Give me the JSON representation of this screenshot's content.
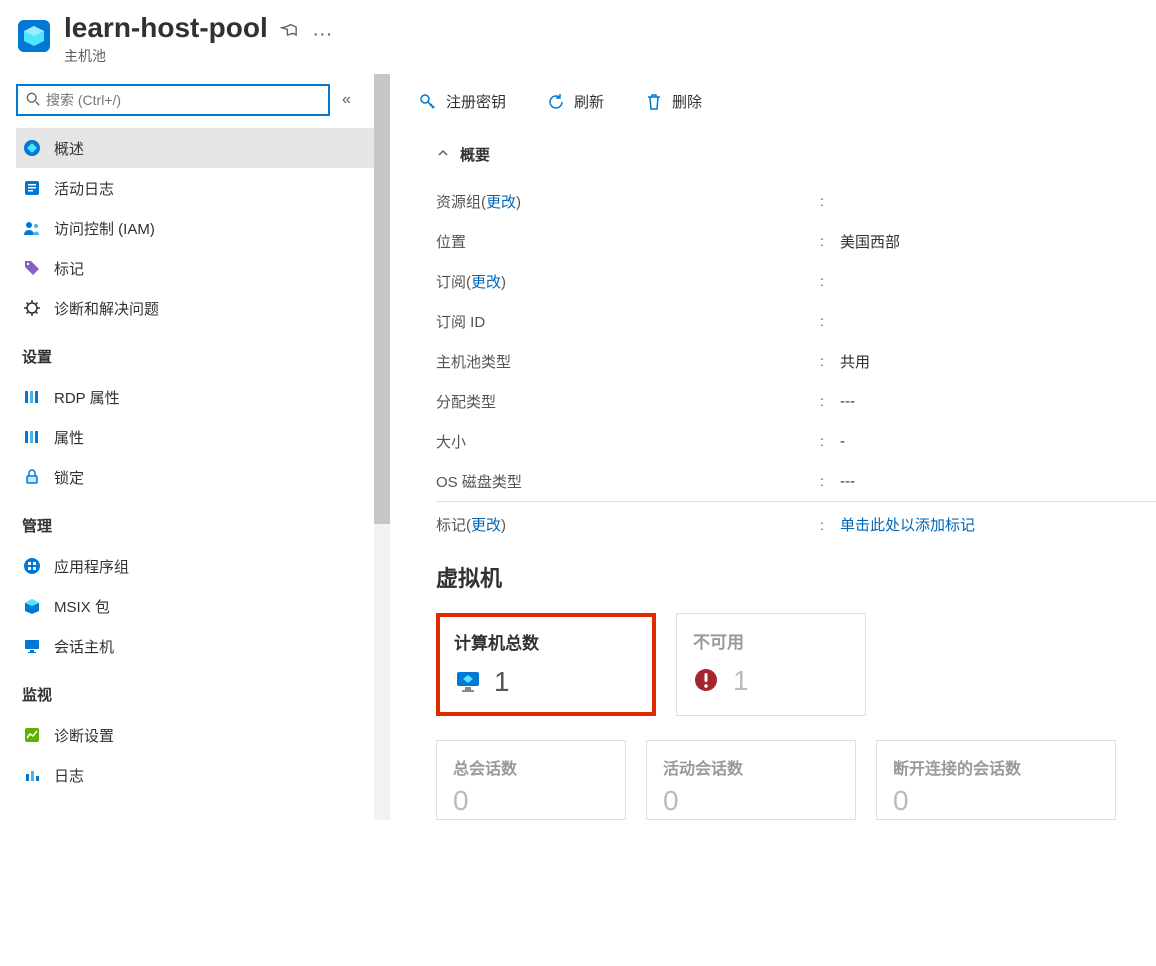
{
  "header": {
    "title": "learn-host-pool",
    "subtitle": "主机池"
  },
  "search": {
    "placeholder": "搜索 (Ctrl+/)"
  },
  "nav": {
    "items_top": [
      {
        "label": "概述"
      },
      {
        "label": "活动日志"
      },
      {
        "label": "访问控制 (IAM)"
      },
      {
        "label": "标记"
      },
      {
        "label": "诊断和解决问题"
      }
    ],
    "section_settings": "设置",
    "items_settings": [
      {
        "label": "RDP 属性"
      },
      {
        "label": "属性"
      },
      {
        "label": "锁定"
      }
    ],
    "section_manage": "管理",
    "items_manage": [
      {
        "label": "应用程序组"
      },
      {
        "label": "MSIX 包"
      },
      {
        "label": "会话主机"
      }
    ],
    "section_monitor": "监视",
    "items_monitor": [
      {
        "label": "诊断设置"
      },
      {
        "label": "日志"
      }
    ]
  },
  "toolbar": {
    "register_key": "注册密钥",
    "refresh": "刷新",
    "delete": "删除"
  },
  "essentials": {
    "header": "概要",
    "rows": {
      "resource_group": {
        "label_pre": "资源组",
        "change": "更改",
        "value": ""
      },
      "location": {
        "label": "位置",
        "value": "美国西部"
      },
      "subscription": {
        "label_pre": "订阅",
        "change": "更改",
        "value": ""
      },
      "subscription_id": {
        "label": "订阅 ID",
        "value": ""
      },
      "hostpool_type": {
        "label": "主机池类型",
        "value": "共用"
      },
      "alloc_type": {
        "label": "分配类型",
        "value": "---"
      },
      "size": {
        "label": "大小",
        "value": "-"
      },
      "os_disk": {
        "label": "OS 磁盘类型",
        "value": "---"
      },
      "tags": {
        "label_pre": "标记",
        "change": "更改",
        "value_link": "单击此处以添加标记"
      }
    }
  },
  "vm": {
    "title": "虚拟机",
    "cards": {
      "total": {
        "title": "计算机总数",
        "value": "1"
      },
      "unavailable": {
        "title": "不可用",
        "value": "1"
      }
    },
    "sessions": {
      "total": {
        "title": "总会话数",
        "value": "0"
      },
      "active": {
        "title": "活动会话数",
        "value": "0"
      },
      "disconnected": {
        "title": "断开连接的会话数",
        "value": "0"
      }
    }
  }
}
